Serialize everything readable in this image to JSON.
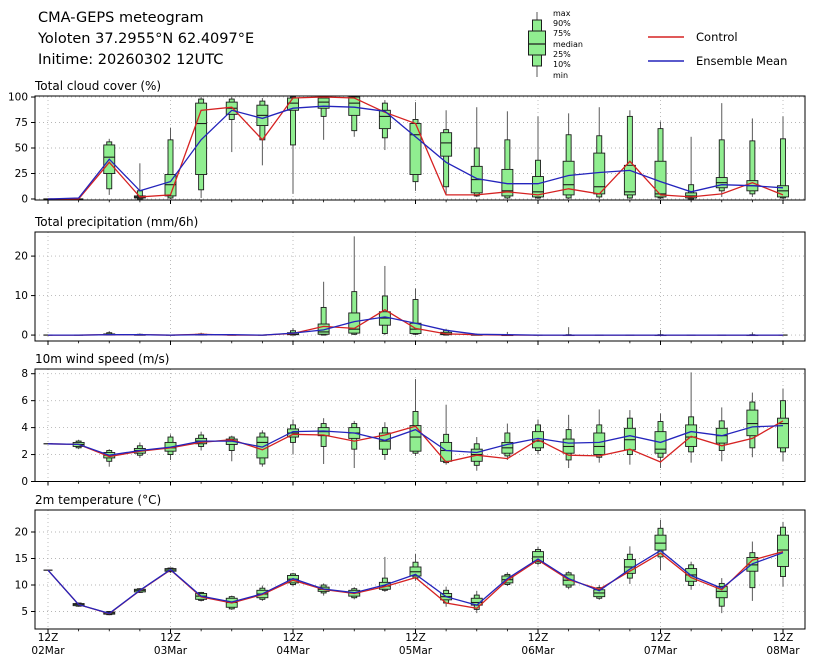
{
  "header": {
    "title": "CMA-GEPS meteogram",
    "location": "Yoloten 37.2955°N 62.4097°E",
    "initime": "Initime: 20260302 12UTC"
  },
  "legend": {
    "box_labels": [
      "max",
      "90%",
      "75%",
      "median",
      "25%",
      "10%",
      "min"
    ],
    "control_label": "Control",
    "ensemble_label": "Ensemble Mean",
    "control_color": "#d62222",
    "ensemble_color": "#2424bc",
    "box_fill": "#90ee90",
    "box_edge": "#1c1c1c",
    "whisker_color": "#5a5a5a"
  },
  "chart_data": {
    "type": "boxplot",
    "n_steps": 25,
    "x_axis": {
      "step_hours": 6,
      "major_ticks": [
        {
          "index": 0,
          "line1": "12Z",
          "line2": "02Mar"
        },
        {
          "index": 4,
          "line1": "12Z",
          "line2": "03Mar"
        },
        {
          "index": 8,
          "line1": "12Z",
          "line2": "04Mar"
        },
        {
          "index": 12,
          "line1": "12Z",
          "line2": "05Mar"
        },
        {
          "index": 16,
          "line1": "12Z",
          "line2": "06Mar"
        },
        {
          "index": 20,
          "line1": "12Z",
          "line2": "07Mar"
        },
        {
          "index": 24,
          "line1": "12Z",
          "line2": "08Mar"
        }
      ]
    },
    "panels": [
      {
        "title": "Total cloud cover (%)",
        "yticks": [
          0,
          25,
          50,
          75,
          100
        ],
        "ylim": [
          -1,
          101
        ],
        "box_stats": {
          "min": [
            0,
            0,
            4,
            0,
            0,
            1,
            46,
            33,
            5,
            58,
            61,
            48,
            8,
            4,
            2,
            0,
            0,
            0,
            0,
            0,
            0,
            0,
            2,
            2,
            0
          ],
          "p10": [
            0,
            0,
            10,
            0,
            1,
            9,
            78,
            58,
            53,
            81,
            67,
            60,
            17,
            12,
            3,
            1,
            1,
            1,
            2,
            1,
            1,
            0,
            8,
            5,
            1
          ],
          "p25": [
            0,
            0,
            25,
            1,
            3,
            24,
            83,
            72,
            87,
            89,
            82,
            69,
            24,
            42,
            6,
            3,
            2,
            4,
            5,
            4,
            2,
            1,
            11,
            8,
            2
          ],
          "median": [
            0,
            0,
            41,
            2,
            14,
            74,
            89,
            82,
            94,
            95,
            94,
            81,
            63,
            55,
            19,
            8,
            7,
            14,
            12,
            7,
            5,
            3,
            16,
            13,
            8
          ],
          "p75": [
            0,
            0,
            53,
            3,
            24,
            94,
            95,
            92,
            99,
            99,
            100,
            87,
            74,
            65,
            32,
            29,
            22,
            37,
            45,
            33,
            37,
            6,
            21,
            18,
            13
          ],
          "p90": [
            0,
            0,
            56,
            8,
            58,
            98,
            98,
            96,
            100,
            100,
            100,
            94,
            78,
            68,
            50,
            58,
            38,
            63,
            62,
            81,
            69,
            14,
            58,
            57,
            59
          ],
          "max": [
            0,
            0,
            59,
            35,
            70,
            100,
            100,
            99,
            100,
            100,
            100,
            97,
            95,
            87,
            90,
            86,
            81,
            84,
            90,
            87,
            76,
            61,
            94,
            79,
            81
          ]
        },
        "control": [
          0,
          0,
          36,
          2,
          4,
          87,
          90,
          58,
          99,
          100,
          99,
          85,
          74,
          4,
          4,
          7,
          4,
          10,
          5,
          37,
          4,
          2,
          5,
          16,
          4
        ],
        "ensemble_mean": [
          0,
          1,
          39,
          8,
          17,
          58,
          87,
          79,
          89,
          91,
          90,
          86,
          61,
          36,
          20,
          15,
          15,
          23,
          26,
          28,
          17,
          7,
          14,
          13,
          11
        ]
      },
      {
        "title": "Total precipitation (mm/6h)",
        "yticks": [
          0,
          10,
          20
        ],
        "ylim": [
          -1.5,
          26.1
        ],
        "box_stats": {
          "min": [
            0,
            0,
            0,
            0,
            0,
            0,
            0,
            0,
            0,
            0,
            0,
            0,
            0,
            0,
            0,
            0,
            0,
            0,
            0,
            0,
            0,
            0,
            0,
            0,
            0
          ],
          "p10": [
            0,
            0,
            0,
            0,
            0,
            0,
            0,
            0,
            0,
            0,
            0.2,
            0.4,
            0.2,
            0,
            0,
            0,
            0,
            0,
            0,
            0,
            0,
            0,
            0,
            0,
            0
          ],
          "p25": [
            0,
            0,
            0,
            0,
            0,
            0,
            0,
            0,
            0.1,
            0.2,
            0.5,
            2.5,
            0.4,
            0.1,
            0,
            0,
            0,
            0,
            0,
            0,
            0,
            0,
            0,
            0,
            0
          ],
          "median": [
            0,
            0,
            0.1,
            0,
            0,
            0.1,
            0,
            0,
            0.2,
            0.8,
            1.5,
            4.3,
            1.5,
            0.3,
            0,
            0,
            0,
            0,
            0,
            0,
            0,
            0,
            0,
            0,
            0
          ],
          "p75": [
            0,
            0,
            0.3,
            0.1,
            0.1,
            0.2,
            0.1,
            0,
            0.6,
            2.8,
            5.6,
            5.9,
            3.0,
            0.7,
            0.1,
            0,
            0,
            0,
            0,
            0,
            0,
            0,
            0,
            0,
            0
          ],
          "p90": [
            0,
            0,
            0.6,
            0.2,
            0.2,
            0.3,
            0.2,
            0.1,
            1.1,
            7.0,
            11.0,
            9.9,
            9.0,
            1.2,
            0.2,
            0.1,
            0,
            0.1,
            0,
            0,
            0.1,
            0,
            0,
            0.1,
            0
          ],
          "max": [
            0,
            0,
            1.0,
            0.4,
            0.3,
            0.6,
            0.3,
            0.2,
            1.8,
            13.5,
            25.0,
            17.5,
            11.8,
            1.6,
            0.4,
            0.8,
            0,
            2.0,
            0,
            0,
            1.3,
            0,
            0,
            0.7,
            0
          ]
        },
        "control": [
          0,
          0,
          0.1,
          0.1,
          0,
          0.2,
          0,
          0,
          0.4,
          2.2,
          1.7,
          6.4,
          1.7,
          0.3,
          0.1,
          0,
          0,
          0,
          0,
          0,
          0,
          0,
          0,
          0,
          0
        ],
        "ensemble_mean": [
          0,
          0,
          0.1,
          0.1,
          0,
          0.1,
          0.1,
          0,
          0.5,
          1.3,
          3.4,
          4.6,
          3.0,
          1.2,
          0.2,
          0.1,
          0,
          0,
          0,
          0,
          0,
          0,
          0,
          0,
          0
        ]
      },
      {
        "title": "10m wind speed (m/s)",
        "yticks": [
          0,
          2,
          4,
          6,
          8
        ],
        "ylim": [
          0,
          8.35
        ],
        "box_stats": {
          "min": [
            2.8,
            2.4,
            1.1,
            1.75,
            1.6,
            2.3,
            1.5,
            1.1,
            2.0,
            1.3,
            1.0,
            1.6,
            1.9,
            1.25,
            0.8,
            1.6,
            2.0,
            1.0,
            1.4,
            1.25,
            1.0,
            1.4,
            1.5,
            1.8,
            1.5
          ],
          "p10": [
            2.8,
            2.5,
            1.5,
            1.95,
            2.0,
            2.6,
            2.3,
            1.3,
            2.9,
            2.6,
            2.4,
            2.0,
            2.1,
            1.4,
            1.2,
            1.9,
            2.3,
            1.6,
            1.8,
            2.0,
            1.8,
            2.2,
            2.3,
            2.5,
            2.2
          ],
          "p25": [
            2.8,
            2.6,
            1.75,
            2.1,
            2.25,
            2.8,
            2.75,
            1.75,
            3.3,
            3.4,
            3.2,
            2.4,
            2.25,
            1.5,
            1.5,
            2.1,
            2.5,
            2.1,
            2.0,
            2.35,
            2.1,
            2.6,
            2.85,
            3.4,
            2.5
          ],
          "median": [
            2.8,
            2.75,
            1.95,
            2.3,
            2.5,
            3.0,
            3.0,
            2.9,
            3.6,
            3.7,
            3.6,
            3.0,
            3.3,
            2.3,
            2.0,
            2.5,
            3.0,
            2.6,
            2.6,
            3.1,
            2.4,
            3.3,
            3.4,
            4.3,
            4.3
          ],
          "p75": [
            2.8,
            2.9,
            2.15,
            2.45,
            2.9,
            3.2,
            3.15,
            3.3,
            3.9,
            4.0,
            4.0,
            3.6,
            4.15,
            2.9,
            2.4,
            2.9,
            3.7,
            3.15,
            3.6,
            3.95,
            3.7,
            4.2,
            3.95,
            5.3,
            4.7
          ],
          "p90": [
            2.8,
            3.0,
            2.3,
            2.65,
            3.3,
            3.45,
            3.3,
            3.6,
            4.2,
            4.3,
            4.3,
            4.0,
            5.2,
            3.5,
            2.8,
            3.6,
            4.2,
            3.85,
            4.2,
            4.7,
            4.45,
            4.8,
            4.5,
            5.9,
            6.0
          ],
          "max": [
            2.8,
            3.1,
            2.4,
            2.9,
            3.5,
            3.7,
            3.4,
            3.8,
            4.6,
            4.7,
            4.5,
            4.4,
            7.6,
            5.7,
            3.3,
            4.3,
            4.6,
            4.95,
            5.35,
            5.3,
            5.05,
            8.1,
            5.5,
            6.6,
            6.9
          ]
        },
        "control": [
          2.8,
          2.75,
          1.85,
          2.25,
          2.5,
          2.9,
          3.1,
          2.35,
          3.5,
          3.45,
          3.0,
          3.45,
          4.1,
          1.45,
          1.95,
          1.7,
          3.1,
          1.95,
          1.9,
          2.4,
          1.45,
          3.35,
          2.65,
          3.2,
          4.5
        ],
        "ensemble_mean": [
          2.8,
          2.75,
          1.95,
          2.3,
          2.55,
          3.0,
          3.0,
          2.55,
          3.7,
          3.75,
          3.6,
          3.05,
          3.85,
          2.3,
          2.15,
          2.75,
          3.2,
          2.85,
          2.9,
          3.4,
          2.9,
          3.7,
          3.4,
          4.05,
          4.15
        ]
      },
      {
        "title": "2m temperature (°C)",
        "yticks": [
          5,
          10,
          15,
          20
        ],
        "ylim": [
          1.7,
          24.15
        ],
        "box_stats": {
          "min": [
            12.8,
            5.9,
            4.3,
            8.5,
            12.3,
            6.9,
            5.3,
            7.0,
            9.8,
            8.0,
            7.3,
            8.7,
            10.8,
            5.9,
            4.7,
            9.8,
            13.7,
            9.2,
            7.2,
            10.2,
            12.8,
            9.1,
            4.7,
            7.0,
            9.7
          ],
          "p10": [
            12.8,
            6.0,
            4.4,
            8.6,
            12.5,
            7.1,
            5.5,
            7.3,
            10.1,
            8.5,
            7.6,
            9.0,
            11.3,
            6.6,
            5.4,
            10.1,
            14.1,
            9.6,
            7.5,
            11.3,
            15.3,
            9.9,
            6.0,
            9.5,
            11.6
          ],
          "p25": [
            12.8,
            6.1,
            4.5,
            8.7,
            12.6,
            7.3,
            5.8,
            7.6,
            10.4,
            8.8,
            7.9,
            9.2,
            11.7,
            7.2,
            6.2,
            10.4,
            14.4,
            10.0,
            7.8,
            12.2,
            16.6,
            10.7,
            7.6,
            12.6,
            13.5
          ],
          "median": [
            12.8,
            6.3,
            4.7,
            9.0,
            12.85,
            7.9,
            6.7,
            8.3,
            11.1,
            9.2,
            8.5,
            9.8,
            12.5,
            7.8,
            6.7,
            11.0,
            15.3,
            10.9,
            8.5,
            13.4,
            17.9,
            11.9,
            8.8,
            13.8,
            16.6
          ],
          "p75": [
            12.8,
            6.5,
            4.9,
            9.2,
            13.1,
            8.4,
            7.5,
            9.0,
            11.8,
            9.6,
            9.0,
            10.5,
            13.4,
            8.4,
            7.5,
            11.7,
            16.3,
            11.9,
            9.1,
            14.8,
            19.4,
            13.1,
            9.7,
            15.2,
            19.4
          ],
          "p90": [
            12.8,
            6.6,
            5.0,
            9.3,
            13.2,
            8.6,
            7.8,
            9.4,
            12.1,
            10.0,
            9.3,
            11.3,
            14.3,
            9.0,
            8.1,
            12.0,
            16.7,
            12.3,
            9.5,
            15.8,
            20.7,
            13.8,
            10.3,
            16.1,
            20.9
          ],
          "max": [
            12.8,
            6.7,
            5.1,
            9.4,
            13.3,
            8.7,
            8.0,
            9.9,
            12.3,
            10.3,
            9.6,
            15.3,
            15.9,
            9.7,
            8.9,
            12.4,
            17.2,
            12.6,
            10.0,
            17.3,
            22.3,
            14.4,
            11.3,
            18.2,
            21.9
          ]
        },
        "control": [
          12.8,
          6.3,
          4.6,
          8.95,
          12.85,
          7.75,
          6.6,
          8.2,
          10.9,
          9.15,
          8.4,
          9.7,
          11.4,
          6.6,
          5.6,
          10.9,
          14.7,
          11.0,
          9.2,
          12.6,
          16.0,
          11.4,
          9.1,
          14.7,
          16.3
        ],
        "ensemble_mean": [
          12.8,
          6.3,
          4.65,
          9.0,
          12.9,
          7.9,
          6.8,
          8.35,
          11.2,
          9.25,
          8.55,
          10.0,
          12.0,
          7.8,
          6.2,
          11.2,
          14.9,
          11.2,
          8.9,
          13.0,
          16.5,
          11.8,
          9.4,
          14.0,
          16.1
        ]
      }
    ]
  }
}
